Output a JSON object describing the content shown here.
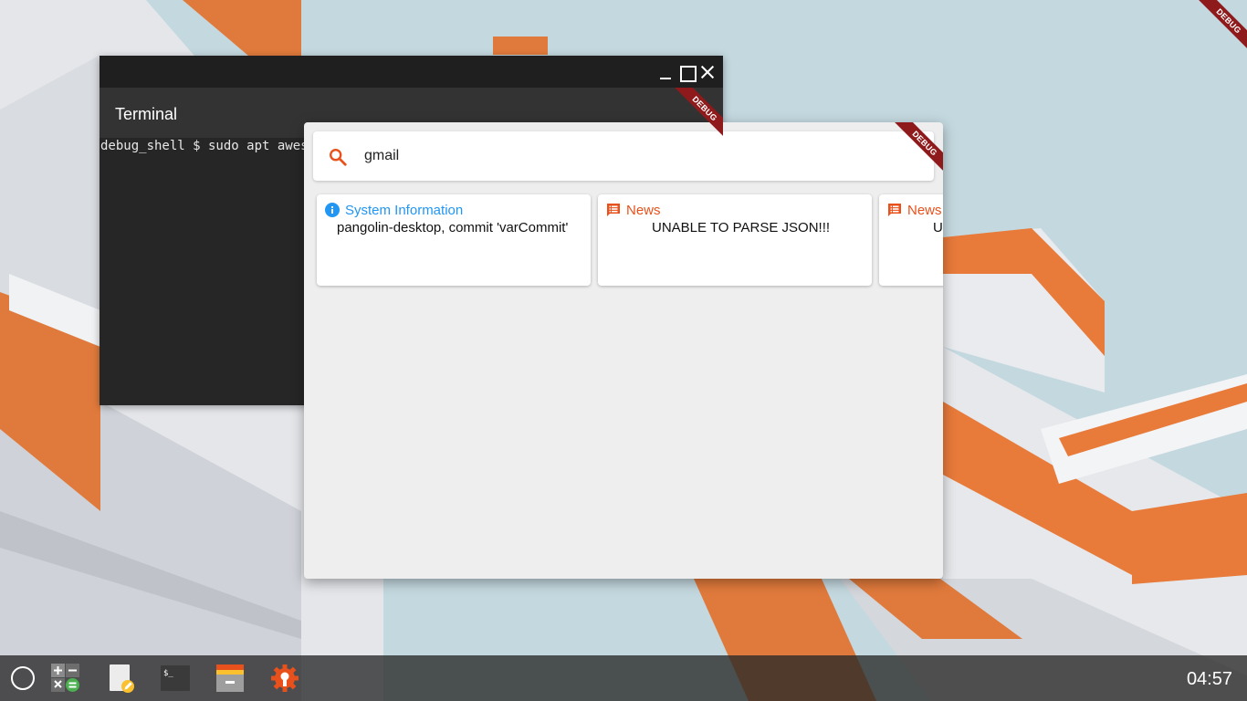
{
  "desktop": {
    "debug_banner": "DEBUG"
  },
  "terminal": {
    "title": "Terminal",
    "command_line": "debug_shell $ sudo apt awesome"
  },
  "launcher": {
    "search": {
      "value": "gmail",
      "icon": "search-icon",
      "accent_color": "#e8511c"
    },
    "cards": [
      {
        "icon": "info-icon",
        "icon_color": "#2196f3",
        "title": "System Information",
        "title_color": "#2196f3",
        "body": "pangolin-desktop, commit 'varCommit'"
      },
      {
        "icon": "news-icon",
        "icon_color": "#e8511c",
        "title": "News",
        "title_color": "#e8511c",
        "body": "UNABLE TO PARSE JSON!!!"
      },
      {
        "icon": "news-icon",
        "icon_color": "#e8511c",
        "title": "News",
        "title_color": "#e8511c",
        "body": "UNABLE TO PARSE JSON!!!"
      }
    ]
  },
  "taskbar": {
    "apps": [
      "launcher-button",
      "calculator-icon",
      "notes-icon",
      "terminal-icon",
      "files-icon",
      "settings-icon"
    ],
    "clock": "04:57"
  }
}
